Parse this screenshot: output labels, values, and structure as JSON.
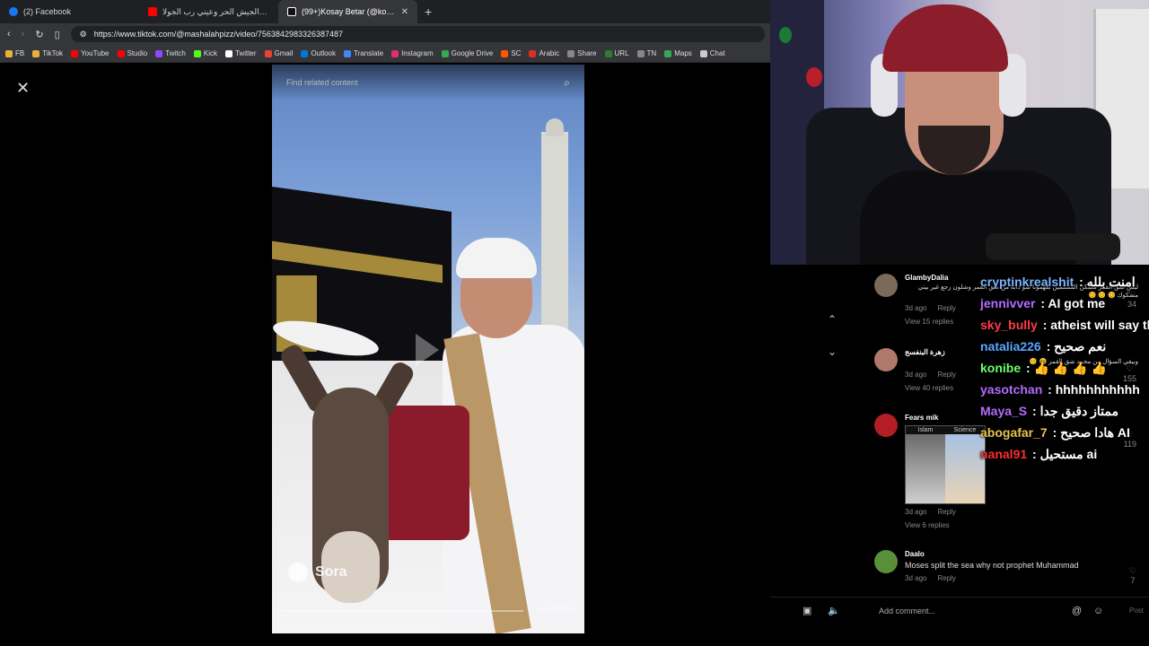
{
  "browser": {
    "tabs": [
      {
        "title": "(2) Facebook",
        "color": "#1877f2",
        "active": false
      },
      {
        "title": "عيني رب الجيش الحر وعيني رب الجولا...",
        "color": "#ff0000",
        "active": false
      },
      {
        "title": "(99+)Kosay Betar (@kosay.betar...",
        "color": "#ffffff",
        "active": true
      }
    ],
    "new_tab": "+",
    "url": "https://www.tiktok.com/@mashalahpizz/video/7563842983326387487",
    "bookmarks": [
      {
        "label": "FB",
        "color": "#e8b339"
      },
      {
        "label": "TikTok",
        "color": "#e8b339"
      },
      {
        "label": "YouTube",
        "color": "#ff0000"
      },
      {
        "label": "Studio",
        "color": "#ff0000"
      },
      {
        "label": "Twitch",
        "color": "#9146ff"
      },
      {
        "label": "Kick",
        "color": "#53fc18"
      },
      {
        "label": "Twitter",
        "color": "#ffffff"
      },
      {
        "label": "Gmail",
        "color": "#ea4335"
      },
      {
        "label": "Outlook",
        "color": "#0078d4"
      },
      {
        "label": "Translate",
        "color": "#4285f4"
      },
      {
        "label": "Instagram",
        "color": "#e1306c"
      },
      {
        "label": "Google Drive",
        "color": "#34a853"
      },
      {
        "label": "SC",
        "color": "#ff5500"
      },
      {
        "label": "Arabic",
        "color": "#d93025"
      },
      {
        "label": "Share",
        "color": "#888888"
      },
      {
        "label": "URL",
        "color": "#2e7d32"
      },
      {
        "label": "TN",
        "color": "#888888"
      },
      {
        "label": "Maps",
        "color": "#34a853"
      },
      {
        "label": "Chat",
        "color": "#cccccc"
      }
    ]
  },
  "video": {
    "search_placeholder": "Find related content",
    "watermark": "Sora",
    "timecode": "00:00/00:18"
  },
  "comments": [
    {
      "user": "GlambyDalia",
      "text": "ليش شق القمر مسكن المسلمين بفهمونا شو دابه من شق القمر وشلون رجع غير بيتي مشكوك 😊 😊 😊",
      "meta": "3d ago",
      "reply": "Reply",
      "more": "View 15 replies",
      "likes": "34",
      "avatar": "#7a6a5a"
    },
    {
      "user": "زهرة البنفسج",
      "text": "وبيقي السؤال من محمد شق القمر 😊 😊",
      "meta": "3d ago",
      "reply": "Reply",
      "more": "View 40 replies",
      "likes": "155",
      "avatar": "#b07a6a"
    },
    {
      "user": "Fears mik",
      "text": "",
      "meta": "3d ago",
      "reply": "Reply",
      "more": "View 6 replies",
      "likes": "119",
      "avatar": "#b21e24",
      "image_labels": [
        "Islam",
        "Science"
      ]
    },
    {
      "user": "Daalo",
      "text": "Moses split the sea why not prophet Muhammad",
      "meta": "3d ago",
      "reply": "Reply",
      "more": "",
      "likes": "7",
      "avatar": "#5a8f3a"
    }
  ],
  "add_comment": {
    "placeholder": "Add comment...",
    "post": "Post"
  },
  "chat": [
    {
      "user": "cryptinkrealshit",
      "user_color": "#7cb3ff",
      "message": " : امنت بلله"
    },
    {
      "user": "jennivver",
      "user_color": "#b46bff",
      "message": " : AI got me"
    },
    {
      "user": "sky_bully",
      "user_color": "#ff3b4a",
      "message": " : atheist will say this is fake"
    },
    {
      "user": "natalia226",
      "user_color": "#5aa6ff",
      "message": " : نعم صحيح"
    },
    {
      "user": "konibe",
      "user_color": "#6bff6b",
      "message": " : 👍 👍 👍 👍"
    },
    {
      "user": "yasotchan",
      "user_color": "#b46bff",
      "message": " : hhhhhhhhhhh"
    },
    {
      "user": "Maya_S",
      "user_color": "#b46bff",
      "message": " : ممتاز دقيق جدا"
    },
    {
      "user": "abogafar_7",
      "user_color": "#e8c44a",
      "message": " : هادا صحيح AI"
    },
    {
      "user": "nanal91",
      "user_color": "#ff2d2d",
      "message": " : مستحيل ai"
    }
  ]
}
